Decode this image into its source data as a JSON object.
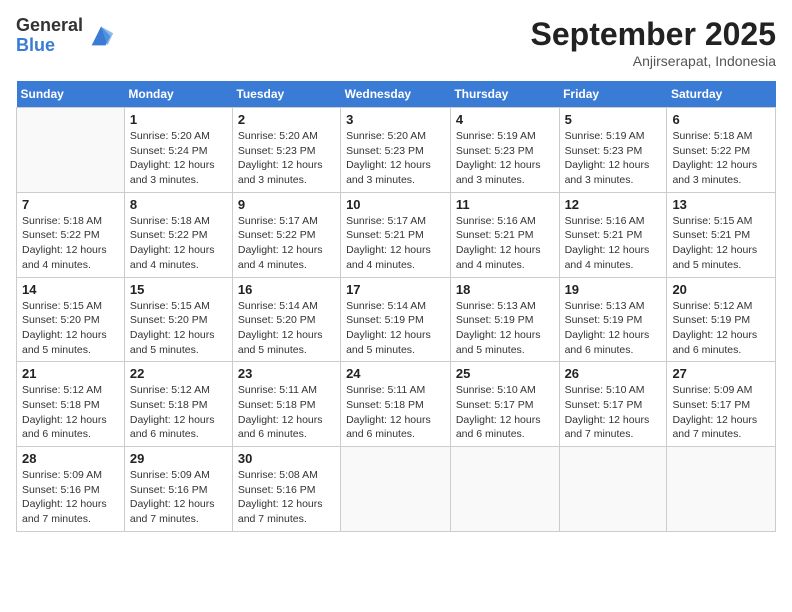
{
  "logo": {
    "general": "General",
    "blue": "Blue"
  },
  "title": "September 2025",
  "subtitle": "Anjirserapat, Indonesia",
  "days_header": [
    "Sunday",
    "Monday",
    "Tuesday",
    "Wednesday",
    "Thursday",
    "Friday",
    "Saturday"
  ],
  "weeks": [
    [
      {
        "day": "",
        "info": ""
      },
      {
        "day": "1",
        "info": "Sunrise: 5:20 AM\nSunset: 5:24 PM\nDaylight: 12 hours\nand 3 minutes."
      },
      {
        "day": "2",
        "info": "Sunrise: 5:20 AM\nSunset: 5:23 PM\nDaylight: 12 hours\nand 3 minutes."
      },
      {
        "day": "3",
        "info": "Sunrise: 5:20 AM\nSunset: 5:23 PM\nDaylight: 12 hours\nand 3 minutes."
      },
      {
        "day": "4",
        "info": "Sunrise: 5:19 AM\nSunset: 5:23 PM\nDaylight: 12 hours\nand 3 minutes."
      },
      {
        "day": "5",
        "info": "Sunrise: 5:19 AM\nSunset: 5:23 PM\nDaylight: 12 hours\nand 3 minutes."
      },
      {
        "day": "6",
        "info": "Sunrise: 5:18 AM\nSunset: 5:22 PM\nDaylight: 12 hours\nand 3 minutes."
      }
    ],
    [
      {
        "day": "7",
        "info": "Sunrise: 5:18 AM\nSunset: 5:22 PM\nDaylight: 12 hours\nand 4 minutes."
      },
      {
        "day": "8",
        "info": "Sunrise: 5:18 AM\nSunset: 5:22 PM\nDaylight: 12 hours\nand 4 minutes."
      },
      {
        "day": "9",
        "info": "Sunrise: 5:17 AM\nSunset: 5:22 PM\nDaylight: 12 hours\nand 4 minutes."
      },
      {
        "day": "10",
        "info": "Sunrise: 5:17 AM\nSunset: 5:21 PM\nDaylight: 12 hours\nand 4 minutes."
      },
      {
        "day": "11",
        "info": "Sunrise: 5:16 AM\nSunset: 5:21 PM\nDaylight: 12 hours\nand 4 minutes."
      },
      {
        "day": "12",
        "info": "Sunrise: 5:16 AM\nSunset: 5:21 PM\nDaylight: 12 hours\nand 4 minutes."
      },
      {
        "day": "13",
        "info": "Sunrise: 5:15 AM\nSunset: 5:21 PM\nDaylight: 12 hours\nand 5 minutes."
      }
    ],
    [
      {
        "day": "14",
        "info": "Sunrise: 5:15 AM\nSunset: 5:20 PM\nDaylight: 12 hours\nand 5 minutes."
      },
      {
        "day": "15",
        "info": "Sunrise: 5:15 AM\nSunset: 5:20 PM\nDaylight: 12 hours\nand 5 minutes."
      },
      {
        "day": "16",
        "info": "Sunrise: 5:14 AM\nSunset: 5:20 PM\nDaylight: 12 hours\nand 5 minutes."
      },
      {
        "day": "17",
        "info": "Sunrise: 5:14 AM\nSunset: 5:19 PM\nDaylight: 12 hours\nand 5 minutes."
      },
      {
        "day": "18",
        "info": "Sunrise: 5:13 AM\nSunset: 5:19 PM\nDaylight: 12 hours\nand 5 minutes."
      },
      {
        "day": "19",
        "info": "Sunrise: 5:13 AM\nSunset: 5:19 PM\nDaylight: 12 hours\nand 6 minutes."
      },
      {
        "day": "20",
        "info": "Sunrise: 5:12 AM\nSunset: 5:19 PM\nDaylight: 12 hours\nand 6 minutes."
      }
    ],
    [
      {
        "day": "21",
        "info": "Sunrise: 5:12 AM\nSunset: 5:18 PM\nDaylight: 12 hours\nand 6 minutes."
      },
      {
        "day": "22",
        "info": "Sunrise: 5:12 AM\nSunset: 5:18 PM\nDaylight: 12 hours\nand 6 minutes."
      },
      {
        "day": "23",
        "info": "Sunrise: 5:11 AM\nSunset: 5:18 PM\nDaylight: 12 hours\nand 6 minutes."
      },
      {
        "day": "24",
        "info": "Sunrise: 5:11 AM\nSunset: 5:18 PM\nDaylight: 12 hours\nand 6 minutes."
      },
      {
        "day": "25",
        "info": "Sunrise: 5:10 AM\nSunset: 5:17 PM\nDaylight: 12 hours\nand 6 minutes."
      },
      {
        "day": "26",
        "info": "Sunrise: 5:10 AM\nSunset: 5:17 PM\nDaylight: 12 hours\nand 7 minutes."
      },
      {
        "day": "27",
        "info": "Sunrise: 5:09 AM\nSunset: 5:17 PM\nDaylight: 12 hours\nand 7 minutes."
      }
    ],
    [
      {
        "day": "28",
        "info": "Sunrise: 5:09 AM\nSunset: 5:16 PM\nDaylight: 12 hours\nand 7 minutes."
      },
      {
        "day": "29",
        "info": "Sunrise: 5:09 AM\nSunset: 5:16 PM\nDaylight: 12 hours\nand 7 minutes."
      },
      {
        "day": "30",
        "info": "Sunrise: 5:08 AM\nSunset: 5:16 PM\nDaylight: 12 hours\nand 7 minutes."
      },
      {
        "day": "",
        "info": ""
      },
      {
        "day": "",
        "info": ""
      },
      {
        "day": "",
        "info": ""
      },
      {
        "day": "",
        "info": ""
      }
    ]
  ]
}
